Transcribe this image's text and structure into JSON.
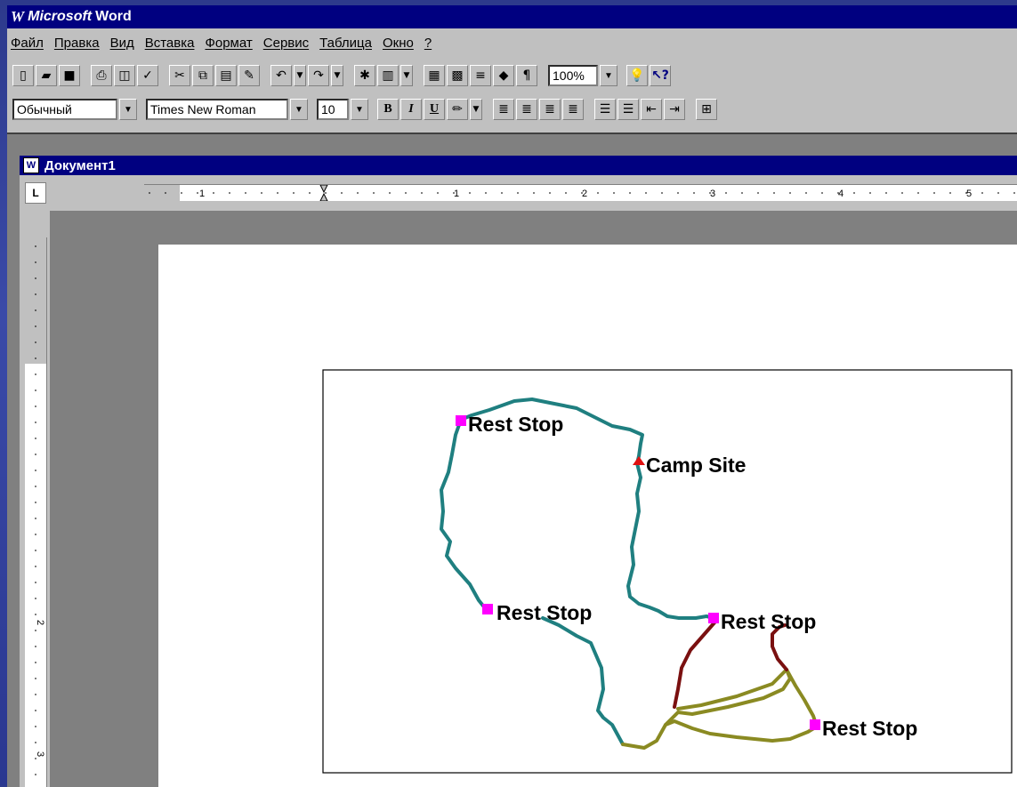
{
  "window": {
    "title_brand": "Microsoft",
    "title_app": "Word"
  },
  "menu": [
    "Файл",
    "Правка",
    "Вид",
    "Вставка",
    "Формат",
    "Сервис",
    "Таблица",
    "Окно",
    "?"
  ],
  "toolbar": {
    "zoom": "100%"
  },
  "formatting": {
    "style": "Обычный",
    "font": "Times New Roman",
    "size": "10",
    "bold": "B",
    "italic": "I",
    "underline": "U"
  },
  "document": {
    "title": "Документ1"
  },
  "ruler": {
    "h_labels": [
      "1",
      "1",
      "2",
      "3",
      "4",
      "5"
    ],
    "v_labels": [
      "2",
      "3"
    ]
  },
  "map": {
    "labels": [
      "Rest Stop",
      "Camp Site",
      "Rest Stop",
      "Rest Stop",
      "Rest Stop"
    ],
    "colors": {
      "trail_teal": "#1f7f80",
      "trail_olive": "#8a8a22",
      "trail_red": "#7a1010",
      "marker": "#ff00ff",
      "camp": "#e01010"
    }
  }
}
